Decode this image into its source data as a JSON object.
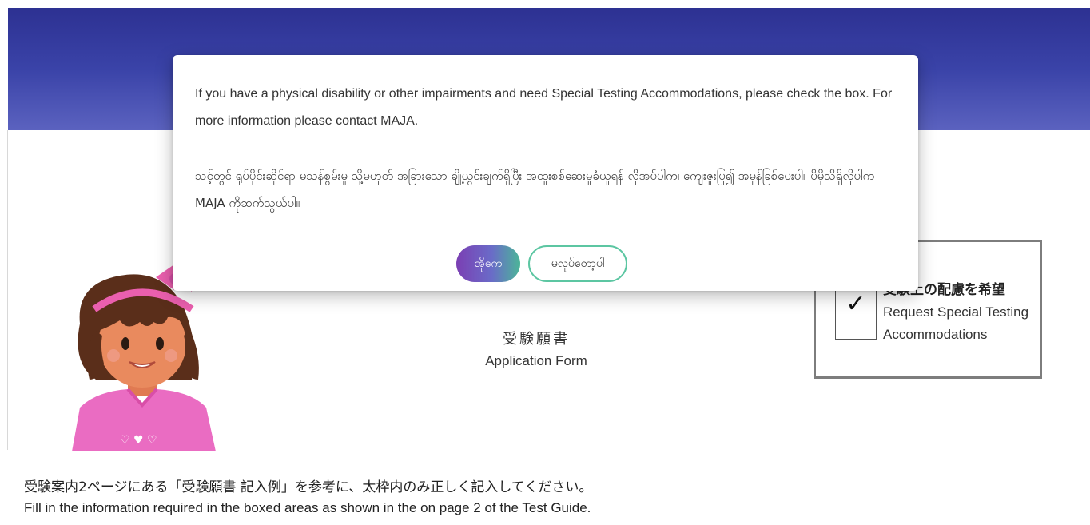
{
  "page": {
    "form_title_jp": "受験願書",
    "form_title_en": "Application Form",
    "accommodation": {
      "checkbox_mark": "✓",
      "label_jp": "受験上の配慮を希望",
      "label_en": "Request Special Testing Accommodations"
    },
    "guide_jp": "受験案内2ページにある「受験願書 記入例」を参考に、太枠内のみ正しく記入してください。",
    "guide_en": "Fill in the information required in the boxed areas as shown in the on page 2 of the Test Guide."
  },
  "modal": {
    "message_en": "If you have a physical disability or other impairments and need Special Testing Accommodations, please check the box. For more information please contact MAJA.",
    "message_my": "သင့်တွင် ရုပ်ပိုင်းဆိုင်ရာ မသန်စွမ်းမှု သို့မဟုတ် အခြားသော ချို့ယွင်းချက်ရှိပြီး အထူးစစ်ဆေးမှုခံယူရန် လိုအပ်ပါက၊ ကျေးဇူးပြု၍ အမှန်ခြစ်ပေးပါ။ ပိုမိုသိရှိလိုပါက MAJA ကိုဆက်သွယ်ပါ။",
    "yes_label": "အိုကေ",
    "no_label": "မလုပ်တော့ပါ"
  },
  "colors": {
    "header_top": "#2d3192",
    "header_bottom": "#5b62bf",
    "yes_gradient_start": "#7b3fb3",
    "yes_gradient_end": "#4bb598",
    "no_border": "#5cc6a2",
    "box_border": "#7d7d7d"
  },
  "illustration": {
    "name": "girl-avatar"
  }
}
